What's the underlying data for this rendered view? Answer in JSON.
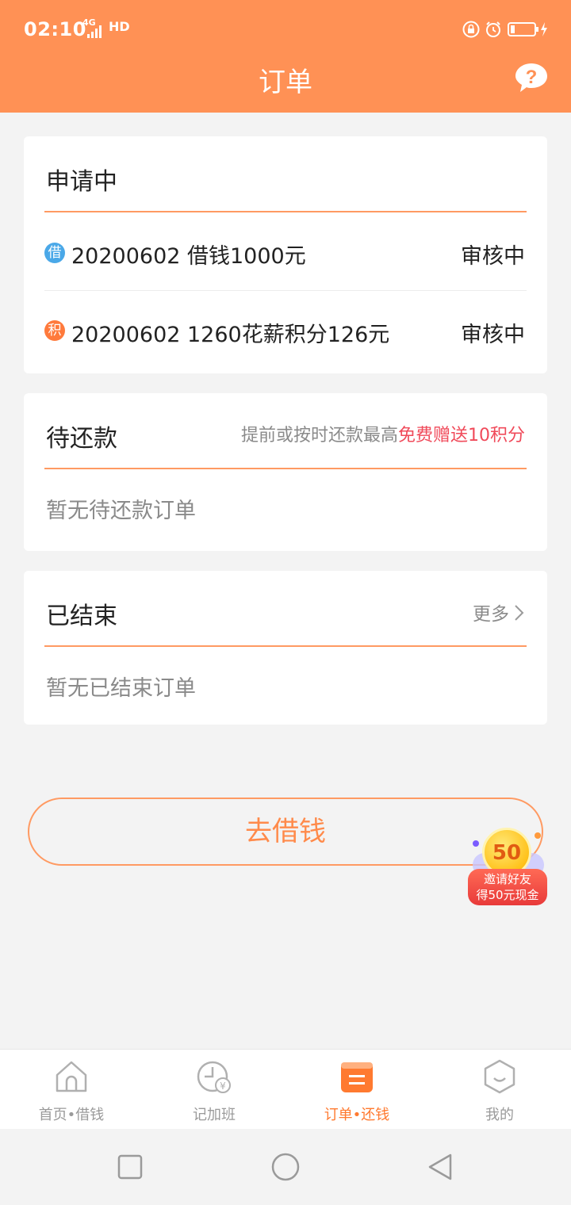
{
  "status_bar": {
    "time": "02:10",
    "network": "4G",
    "hd": "HD",
    "icons": [
      "signal-icon",
      "lock-icon",
      "alarm-icon",
      "battery-icon",
      "charging-icon"
    ]
  },
  "header": {
    "title": "订单",
    "help_icon": "question-icon",
    "background_color": "#ff9155"
  },
  "applying": {
    "title": "申请中",
    "rows": [
      {
        "badge": "借",
        "badge_color": "#4aa8e8",
        "text": "20200602   借钱1000元",
        "status": "审核中"
      },
      {
        "badge": "积",
        "badge_color": "#ff7a3c",
        "text": "20200602   1260花薪积分126元",
        "status": "审核中"
      }
    ]
  },
  "pending": {
    "title": "待还款",
    "hint_prefix": "提前或按时还款最高",
    "hint_highlight": "免费赠送10积分",
    "empty": "暂无待还款订单"
  },
  "finished": {
    "title": "已结束",
    "more_label": "更多",
    "empty": "暂无已结束订单"
  },
  "borrow_button": "去借钱",
  "invite_badge": {
    "coin": "50",
    "line1": "邀请好友",
    "line2": "得50元现金"
  },
  "tabbar": {
    "tabs": [
      {
        "label": "首页•借钱",
        "icon": "home-icon",
        "active": false
      },
      {
        "label": "记加班",
        "icon": "clock-yen-icon",
        "active": false
      },
      {
        "label": "订单•还钱",
        "icon": "order-list-icon",
        "active": true
      },
      {
        "label": "我的",
        "icon": "profile-smile-icon",
        "active": false
      }
    ],
    "accent_color": "#ff7a30"
  },
  "system_nav": [
    "recents-square-icon",
    "home-circle-icon",
    "back-triangle-icon"
  ]
}
